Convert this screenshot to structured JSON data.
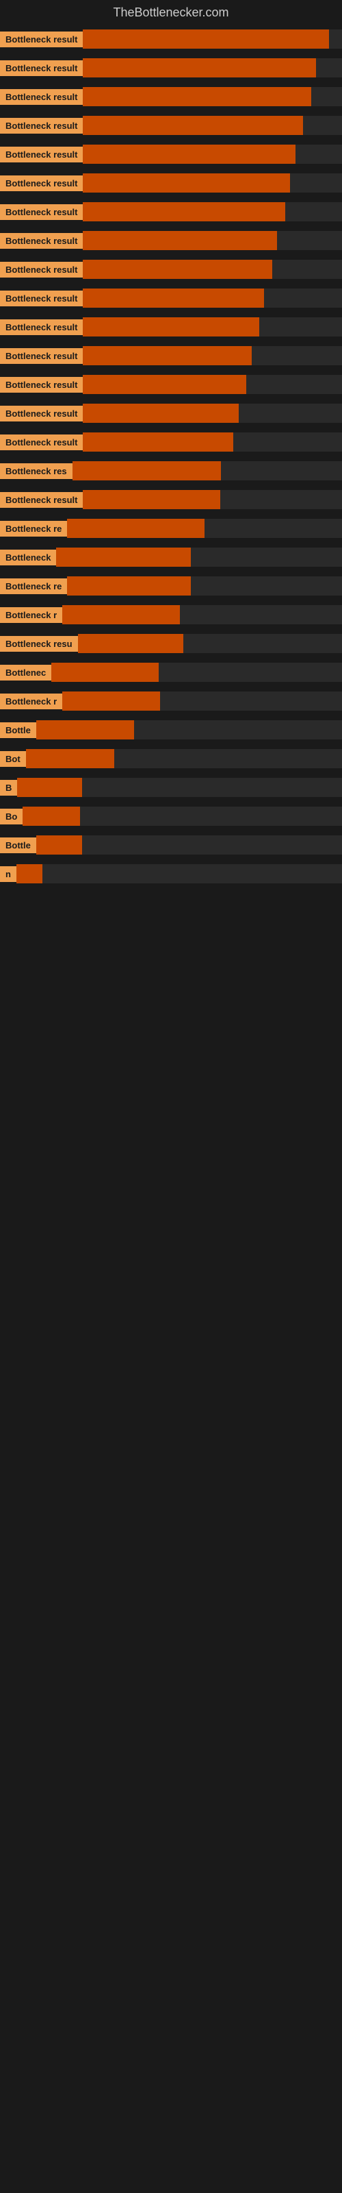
{
  "header": {
    "title": "TheBottlenecker.com"
  },
  "bars": [
    {
      "label": "Bottleneck result",
      "fill": 95
    },
    {
      "label": "Bottleneck result",
      "fill": 90
    },
    {
      "label": "Bottleneck result",
      "fill": 88
    },
    {
      "label": "Bottleneck result",
      "fill": 85
    },
    {
      "label": "Bottleneck result",
      "fill": 82
    },
    {
      "label": "Bottleneck result",
      "fill": 80
    },
    {
      "label": "Bottleneck result",
      "fill": 78
    },
    {
      "label": "Bottleneck result",
      "fill": 75
    },
    {
      "label": "Bottleneck result",
      "fill": 73
    },
    {
      "label": "Bottleneck result",
      "fill": 70
    },
    {
      "label": "Bottleneck result",
      "fill": 68
    },
    {
      "label": "Bottleneck result",
      "fill": 65
    },
    {
      "label": "Bottleneck result",
      "fill": 63
    },
    {
      "label": "Bottleneck result",
      "fill": 60
    },
    {
      "label": "Bottleneck result",
      "fill": 58
    },
    {
      "label": "Bottleneck res",
      "fill": 55
    },
    {
      "label": "Bottleneck result",
      "fill": 53
    },
    {
      "label": "Bottleneck re",
      "fill": 50
    },
    {
      "label": "Bottleneck",
      "fill": 47
    },
    {
      "label": "Bottleneck re",
      "fill": 45
    },
    {
      "label": "Bottleneck r",
      "fill": 42
    },
    {
      "label": "Bottleneck resu",
      "fill": 40
    },
    {
      "label": "Bottlenec",
      "fill": 37
    },
    {
      "label": "Bottleneck r",
      "fill": 35
    },
    {
      "label": "Bottle",
      "fill": 32
    },
    {
      "label": "Bot",
      "fill": 28
    },
    {
      "label": "B",
      "fill": 20
    },
    {
      "label": "Bo",
      "fill": 18
    },
    {
      "label": "Bottle",
      "fill": 15
    },
    {
      "label": "n",
      "fill": 8
    }
  ]
}
